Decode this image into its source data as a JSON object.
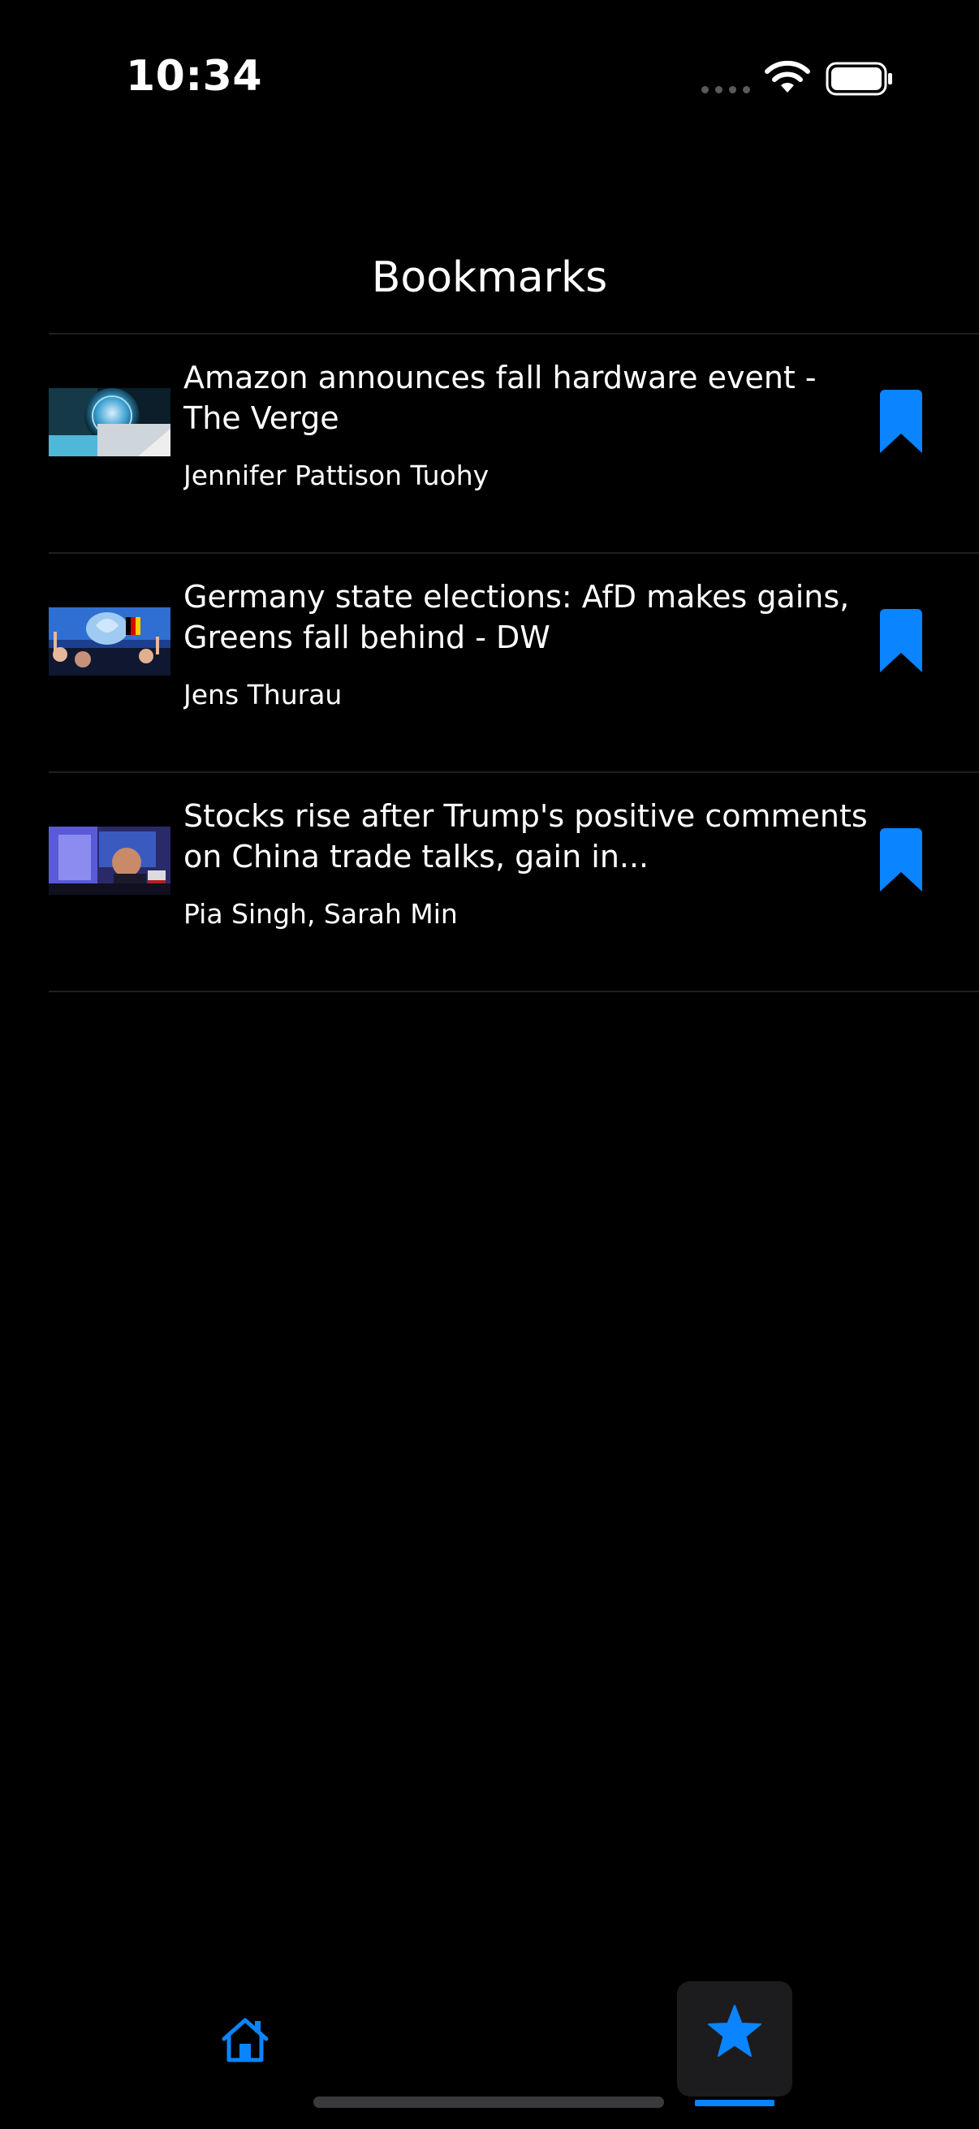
{
  "status_bar": {
    "time": "10:34"
  },
  "header": {
    "title": "Bookmarks"
  },
  "bookmarks": [
    {
      "title": "Amazon announces fall hardware event - The Verge",
      "author": "Jennifer Pattison Tuohy"
    },
    {
      "title": "Germany state elections: AfD makes gains, Greens fall behind - DW",
      "author": "Jens Thurau"
    },
    {
      "title": "Stocks rise after Trump's positive comments on China trade talks, gain in...",
      "author": "Pia Singh, Sarah Min"
    }
  ],
  "tab_bar": {
    "tabs": [
      {
        "icon": "home-icon",
        "selected": false
      },
      {
        "icon": "star-icon",
        "selected": true
      }
    ]
  },
  "colors": {
    "accent": "#0a84ff",
    "background": "#000000",
    "divider": "#1f1f1f",
    "selected_tab_bg": "#1c1c1e"
  }
}
